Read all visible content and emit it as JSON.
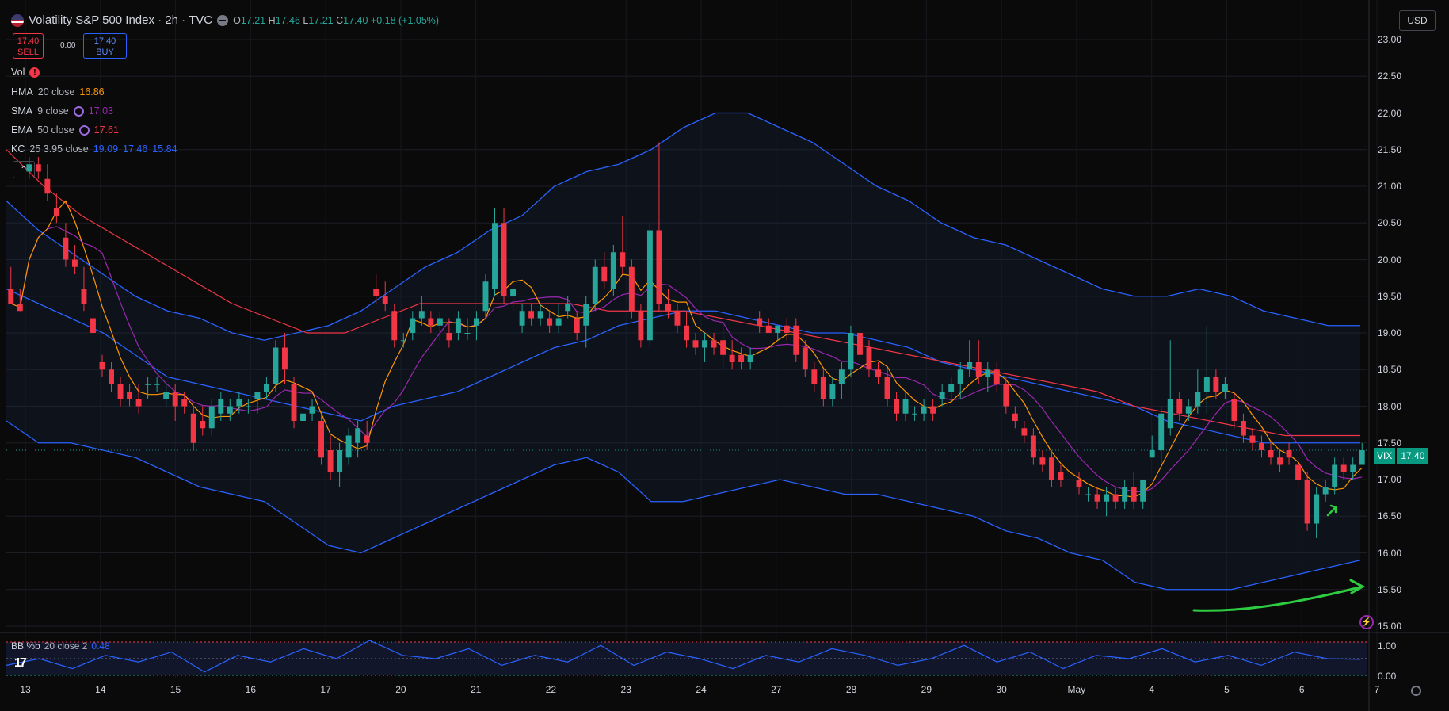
{
  "header": {
    "symbol_title": "Volatility S&P 500 Index · 2h · TVC",
    "ohlc": {
      "o_label": "O",
      "o": "17.21",
      "h_label": "H",
      "h": "17.46",
      "l_label": "L",
      "l": "17.21",
      "c_label": "C",
      "c": "17.40",
      "change": "+0.18 (+1.05%)"
    }
  },
  "trade": {
    "sell_price": "17.40",
    "sell_label": "SELL",
    "spread": "0.00",
    "buy_price": "17.40",
    "buy_label": "BUY"
  },
  "indicators": {
    "vol": {
      "name": "Vol"
    },
    "hma": {
      "name": "HMA",
      "params": "20 close",
      "value": "16.86",
      "color": "#ff9800"
    },
    "sma": {
      "name": "SMA",
      "params": "9 close",
      "value": "17.03",
      "color": "#9c27b0"
    },
    "ema": {
      "name": "EMA",
      "params": "50 close",
      "value": "17.61",
      "color": "#f23645"
    },
    "kc": {
      "name": "KC",
      "params": "25 3.95 close",
      "upper": "19.09",
      "basis": "17.46",
      "lower": "15.84",
      "color": "#2962ff"
    }
  },
  "bb_panel": {
    "name": "BB %b",
    "params": "20 close 2",
    "value": "0.48",
    "y_ticks": [
      "1.00",
      "0.00"
    ]
  },
  "currency_button": "USD",
  "last_price_tag": {
    "symbol": "VIX",
    "value": "17.40"
  },
  "collapse_icon": "chevron-up-icon",
  "colors": {
    "up": "#26a69a",
    "down": "#f23645",
    "background": "#0a0a0b"
  },
  "chart_data": {
    "type": "candlestick",
    "y_ticks": [
      "23.00",
      "22.50",
      "22.00",
      "21.50",
      "21.00",
      "20.50",
      "20.00",
      "19.50",
      "19.00",
      "18.50",
      "18.00",
      "17.50",
      "17.00",
      "16.50",
      "16.00",
      "15.50",
      "15.00"
    ],
    "ylim": [
      15.0,
      23.0
    ],
    "x_ticks": [
      "13",
      "14",
      "15",
      "16",
      "17",
      "20",
      "21",
      "22",
      "23",
      "24",
      "27",
      "28",
      "29",
      "30",
      "May",
      "4",
      "5",
      "6",
      "7"
    ],
    "candles": [
      [
        19.6,
        19.9,
        19.4,
        19.4
      ],
      [
        19.4,
        19.6,
        19.3,
        19.3
      ],
      [
        21.2,
        21.4,
        21.1,
        21.3
      ],
      [
        21.3,
        21.4,
        21.1,
        21.2
      ],
      [
        21.1,
        21.3,
        20.8,
        20.9
      ],
      [
        20.7,
        20.9,
        20.5,
        20.6
      ],
      [
        20.3,
        20.5,
        19.9,
        20.0
      ],
      [
        20.0,
        20.2,
        19.8,
        19.9
      ],
      [
        19.6,
        19.9,
        19.3,
        19.4
      ],
      [
        19.2,
        19.4,
        18.9,
        19.0
      ],
      [
        18.6,
        18.7,
        18.4,
        18.5
      ],
      [
        18.5,
        18.6,
        18.2,
        18.3
      ],
      [
        18.3,
        18.4,
        18.0,
        18.1
      ],
      [
        18.2,
        18.3,
        18.0,
        18.1
      ],
      [
        18.1,
        18.3,
        17.9,
        18.0
      ],
      [
        18.3,
        18.4,
        18.1,
        18.3
      ],
      [
        18.3,
        18.4,
        18.2,
        18.3
      ],
      [
        18.1,
        18.3,
        18.0,
        18.2
      ],
      [
        18.2,
        18.3,
        17.8,
        18.0
      ],
      [
        18.1,
        18.2,
        17.9,
        18.0
      ],
      [
        17.9,
        18.0,
        17.4,
        17.5
      ],
      [
        17.8,
        18.0,
        17.6,
        17.7
      ],
      [
        17.7,
        18.1,
        17.6,
        18.0
      ],
      [
        17.9,
        18.2,
        17.8,
        18.1
      ],
      [
        17.9,
        18.1,
        17.8,
        18.0
      ],
      [
        18.0,
        18.2,
        17.9,
        18.1
      ],
      [
        18.0,
        18.1,
        17.9,
        18.0
      ],
      [
        18.1,
        18.2,
        17.9,
        18.2
      ],
      [
        18.2,
        18.4,
        18.1,
        18.3
      ],
      [
        18.3,
        18.9,
        18.2,
        18.8
      ],
      [
        18.8,
        19.0,
        18.3,
        18.5
      ],
      [
        18.3,
        18.4,
        17.7,
        17.8
      ],
      [
        17.8,
        18.0,
        17.7,
        17.9
      ],
      [
        17.9,
        18.1,
        17.8,
        18.0
      ],
      [
        17.8,
        17.9,
        17.2,
        17.3
      ],
      [
        17.4,
        17.6,
        17.0,
        17.1
      ],
      [
        17.1,
        17.5,
        16.9,
        17.4
      ],
      [
        17.3,
        17.7,
        17.2,
        17.6
      ],
      [
        17.5,
        17.8,
        17.3,
        17.7
      ],
      [
        17.6,
        17.8,
        17.4,
        17.5
      ],
      [
        19.6,
        19.8,
        19.4,
        19.5
      ],
      [
        19.5,
        19.7,
        19.3,
        19.4
      ],
      [
        19.3,
        19.4,
        18.8,
        18.9
      ],
      [
        18.9,
        19.0,
        18.8,
        18.9
      ],
      [
        19.0,
        19.3,
        18.9,
        19.2
      ],
      [
        19.2,
        19.5,
        19.1,
        19.3
      ],
      [
        19.2,
        19.3,
        19.0,
        19.1
      ],
      [
        19.1,
        19.3,
        18.9,
        19.2
      ],
      [
        19.0,
        19.2,
        18.8,
        18.9
      ],
      [
        19.0,
        19.3,
        18.9,
        19.2
      ],
      [
        19.0,
        19.2,
        18.9,
        19.0
      ],
      [
        19.1,
        19.3,
        18.9,
        19.2
      ],
      [
        19.3,
        19.8,
        19.2,
        19.7
      ],
      [
        19.6,
        20.7,
        19.5,
        20.5
      ],
      [
        20.5,
        20.7,
        19.4,
        19.5
      ],
      [
        19.5,
        19.7,
        19.3,
        19.6
      ],
      [
        19.1,
        19.4,
        19.0,
        19.3
      ],
      [
        19.3,
        19.4,
        19.1,
        19.2
      ],
      [
        19.2,
        19.4,
        19.1,
        19.3
      ],
      [
        19.2,
        19.3,
        19.0,
        19.1
      ],
      [
        19.1,
        19.4,
        19.0,
        19.2
      ],
      [
        19.3,
        19.5,
        19.2,
        19.4
      ],
      [
        19.2,
        19.3,
        18.9,
        19.0
      ],
      [
        19.1,
        19.5,
        18.8,
        19.4
      ],
      [
        19.4,
        20.0,
        19.3,
        19.9
      ],
      [
        19.9,
        20.1,
        19.6,
        19.7
      ],
      [
        19.6,
        20.2,
        19.5,
        20.1
      ],
      [
        20.1,
        20.6,
        19.8,
        19.9
      ],
      [
        19.9,
        20.0,
        19.2,
        19.3
      ],
      [
        19.3,
        19.4,
        18.8,
        18.9
      ],
      [
        18.9,
        20.5,
        18.8,
        20.4
      ],
      [
        20.4,
        21.6,
        19.3,
        19.4
      ],
      [
        19.4,
        19.6,
        19.2,
        19.3
      ],
      [
        19.3,
        19.4,
        19.0,
        19.1
      ],
      [
        19.1,
        19.3,
        18.8,
        18.9
      ],
      [
        18.9,
        19.0,
        18.7,
        18.8
      ],
      [
        18.8,
        19.0,
        18.6,
        18.9
      ],
      [
        18.9,
        19.0,
        18.7,
        18.8
      ],
      [
        18.9,
        19.1,
        18.5,
        18.7
      ],
      [
        18.7,
        18.9,
        18.5,
        18.6
      ],
      [
        18.7,
        18.8,
        18.5,
        18.6
      ],
      [
        18.6,
        18.8,
        18.5,
        18.7
      ],
      [
        19.2,
        19.3,
        19.0,
        19.1
      ],
      [
        19.1,
        19.2,
        19.0,
        19.0
      ],
      [
        19.0,
        19.1,
        18.9,
        19.1
      ],
      [
        19.1,
        19.2,
        18.9,
        19.0
      ],
      [
        19.1,
        19.2,
        18.6,
        18.7
      ],
      [
        18.8,
        18.9,
        18.4,
        18.5
      ],
      [
        18.5,
        18.6,
        18.2,
        18.3
      ],
      [
        18.4,
        18.5,
        18.0,
        18.1
      ],
      [
        18.1,
        18.4,
        18.0,
        18.3
      ],
      [
        18.3,
        18.6,
        18.1,
        18.5
      ],
      [
        18.5,
        19.1,
        18.4,
        19.0
      ],
      [
        19.0,
        19.1,
        18.6,
        18.7
      ],
      [
        18.8,
        18.9,
        18.4,
        18.5
      ],
      [
        18.5,
        18.6,
        18.3,
        18.4
      ],
      [
        18.4,
        18.5,
        18.0,
        18.1
      ],
      [
        18.1,
        18.2,
        17.8,
        17.9
      ],
      [
        17.9,
        18.2,
        17.8,
        18.1
      ],
      [
        17.9,
        18.0,
        17.8,
        17.9
      ],
      [
        17.9,
        18.1,
        17.8,
        18.0
      ],
      [
        18.0,
        18.1,
        17.8,
        17.9
      ],
      [
        18.1,
        18.3,
        18.0,
        18.2
      ],
      [
        18.2,
        18.4,
        18.1,
        18.3
      ],
      [
        18.3,
        18.6,
        18.1,
        18.5
      ],
      [
        18.5,
        18.9,
        18.4,
        18.6
      ],
      [
        18.6,
        18.9,
        18.3,
        18.4
      ],
      [
        18.4,
        18.6,
        18.2,
        18.5
      ],
      [
        18.5,
        18.6,
        18.2,
        18.3
      ],
      [
        18.3,
        18.4,
        17.9,
        18.0
      ],
      [
        17.9,
        18.0,
        17.7,
        17.8
      ],
      [
        17.7,
        17.8,
        17.5,
        17.6
      ],
      [
        17.6,
        17.7,
        17.2,
        17.3
      ],
      [
        17.3,
        17.4,
        17.1,
        17.2
      ],
      [
        17.3,
        17.4,
        16.9,
        17.0
      ],
      [
        17.1,
        17.2,
        16.9,
        17.0
      ],
      [
        17.0,
        17.1,
        16.8,
        17.0
      ],
      [
        17.0,
        17.1,
        16.8,
        16.9
      ],
      [
        16.8,
        16.9,
        16.7,
        16.8
      ],
      [
        16.8,
        16.9,
        16.6,
        16.7
      ],
      [
        16.7,
        16.9,
        16.5,
        16.8
      ],
      [
        16.8,
        16.9,
        16.6,
        16.7
      ],
      [
        16.7,
        17.0,
        16.6,
        16.9
      ],
      [
        16.9,
        17.1,
        16.6,
        16.7
      ],
      [
        16.7,
        17.0,
        16.6,
        17.0
      ],
      [
        17.3,
        17.6,
        17.3,
        17.4
      ],
      [
        17.4,
        18.0,
        17.2,
        17.9
      ],
      [
        17.7,
        18.9,
        17.6,
        18.1
      ],
      [
        18.1,
        18.2,
        17.8,
        17.9
      ],
      [
        17.9,
        18.1,
        17.8,
        18.0
      ],
      [
        18.0,
        18.5,
        17.9,
        18.2
      ],
      [
        18.2,
        19.1,
        17.9,
        18.4
      ],
      [
        18.4,
        18.5,
        18.1,
        18.2
      ],
      [
        18.2,
        18.4,
        18.1,
        18.3
      ],
      [
        18.1,
        18.2,
        17.7,
        17.8
      ],
      [
        17.8,
        17.9,
        17.5,
        17.6
      ],
      [
        17.6,
        17.7,
        17.4,
        17.5
      ],
      [
        17.5,
        17.6,
        17.3,
        17.4
      ],
      [
        17.4,
        17.5,
        17.2,
        17.3
      ],
      [
        17.3,
        17.4,
        17.1,
        17.2
      ],
      [
        17.4,
        17.5,
        17.2,
        17.3
      ],
      [
        17.2,
        17.3,
        16.9,
        17.0
      ],
      [
        17.0,
        17.1,
        16.3,
        16.4
      ],
      [
        16.4,
        16.9,
        16.2,
        16.8
      ],
      [
        16.8,
        17.0,
        16.7,
        16.9
      ],
      [
        16.9,
        17.3,
        16.8,
        17.2
      ],
      [
        17.2,
        17.3,
        17.0,
        17.1
      ],
      [
        17.1,
        17.3,
        17.0,
        17.2
      ],
      [
        17.2,
        17.5,
        17.2,
        17.4
      ]
    ],
    "kc_upper": [
      20.8,
      20.4,
      20.1,
      19.8,
      19.5,
      19.3,
      19.2,
      19.0,
      18.9,
      19.0,
      19.1,
      19.3,
      19.6,
      19.9,
      20.1,
      20.4,
      20.6,
      21.0,
      21.2,
      21.3,
      21.5,
      21.8,
      22.0,
      22.0,
      21.8,
      21.6,
      21.3,
      21.0,
      20.8,
      20.5,
      20.3,
      20.2,
      20.0,
      19.8,
      19.6,
      19.5,
      19.5,
      19.6,
      19.5,
      19.3,
      19.2,
      19.1,
      19.1
    ],
    "kc_basis": [
      19.6,
      19.4,
      19.2,
      19.0,
      18.7,
      18.4,
      18.3,
      18.2,
      18.1,
      18.0,
      17.9,
      17.8,
      18.0,
      18.1,
      18.2,
      18.4,
      18.6,
      18.8,
      18.9,
      19.1,
      19.2,
      19.3,
      19.3,
      19.2,
      19.1,
      19.0,
      19.0,
      18.9,
      18.8,
      18.6,
      18.5,
      18.4,
      18.3,
      18.2,
      18.1,
      18.0,
      17.8,
      17.7,
      17.6,
      17.5,
      17.5,
      17.5,
      17.5
    ],
    "kc_lower": [
      17.8,
      17.5,
      17.5,
      17.4,
      17.3,
      17.1,
      16.9,
      16.8,
      16.7,
      16.4,
      16.1,
      16.0,
      16.2,
      16.4,
      16.6,
      16.8,
      17.0,
      17.2,
      17.3,
      17.1,
      16.7,
      16.7,
      16.8,
      16.9,
      17.0,
      16.9,
      16.8,
      16.8,
      16.7,
      16.6,
      16.5,
      16.3,
      16.2,
      16.0,
      15.9,
      15.6,
      15.5,
      15.5,
      15.5,
      15.6,
      15.7,
      15.8,
      15.9
    ],
    "ema50": [
      21.5,
      21.0,
      20.6,
      20.3,
      20.0,
      19.7,
      19.4,
      19.2,
      19.0,
      19.0,
      19.2,
      19.4,
      19.4,
      19.4,
      19.4,
      19.4,
      19.3,
      19.3,
      19.3,
      19.2,
      19.1,
      19.0,
      18.9,
      18.8,
      18.7,
      18.6,
      18.5,
      18.4,
      18.3,
      18.2,
      18.0,
      17.9,
      17.8,
      17.7,
      17.6,
      17.6,
      17.6
    ],
    "bb_pct_b": [
      0.3,
      0.5,
      0.2,
      0.6,
      0.4,
      0.7,
      0.1,
      0.6,
      0.4,
      0.8,
      0.5,
      1.05,
      0.6,
      0.5,
      0.8,
      0.3,
      0.6,
      0.4,
      0.9,
      0.3,
      0.7,
      0.5,
      0.2,
      0.6,
      0.4,
      0.8,
      0.6,
      0.3,
      0.5,
      0.9,
      0.4,
      0.7,
      0.2,
      0.6,
      0.5,
      0.8,
      0.4,
      0.6,
      0.3,
      0.7,
      0.5,
      0.48
    ]
  }
}
